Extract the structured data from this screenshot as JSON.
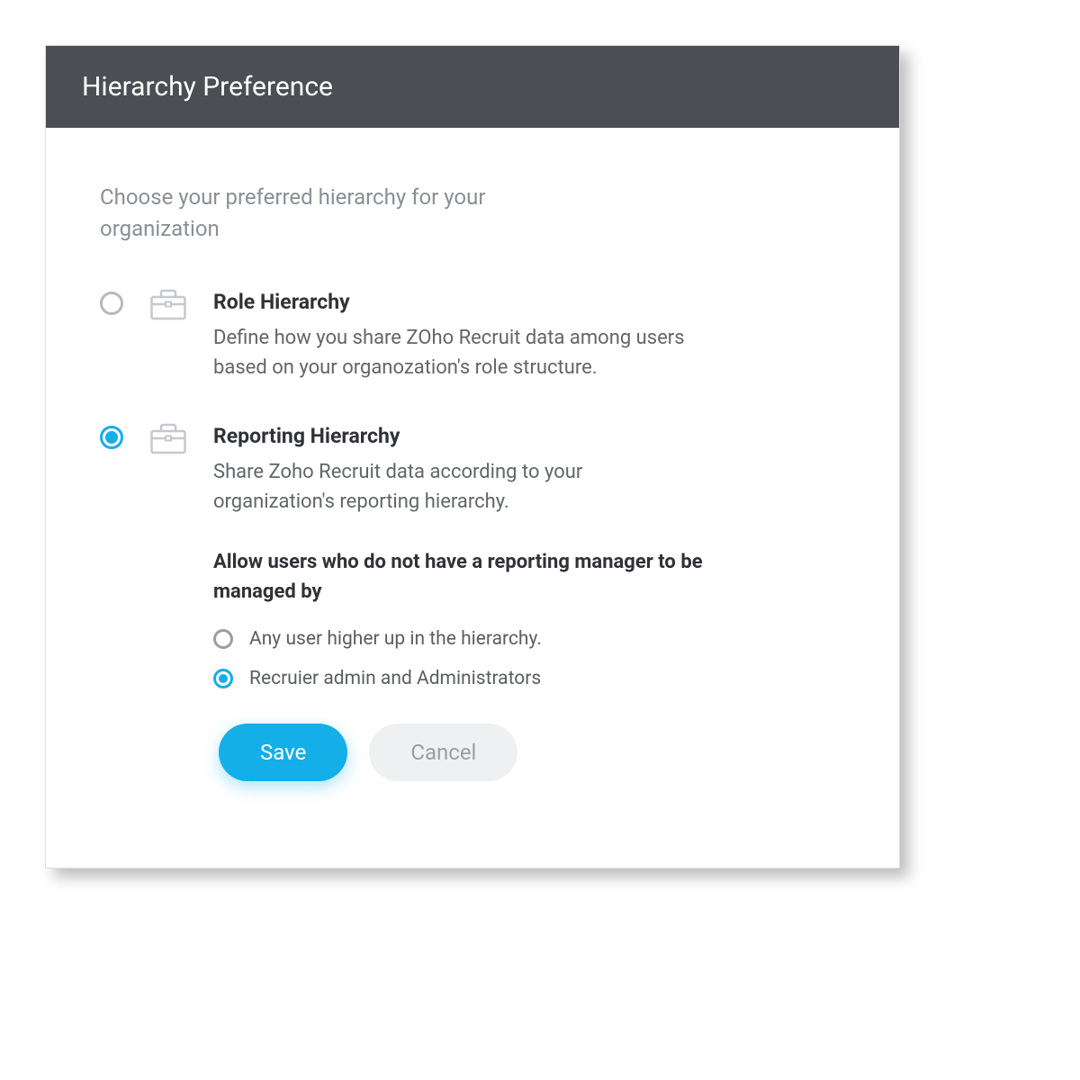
{
  "dialog": {
    "title": "Hierarchy Preference",
    "intro": "Choose your preferred hierarchy for your organization"
  },
  "options": [
    {
      "title": "Role Hierarchy",
      "description": "Define how you share ZOho Recruit data among users based on your organozation's role structure.",
      "selected": false
    },
    {
      "title": "Reporting Hierarchy",
      "description": "Share Zoho Recruit data according to your organization's reporting hierarchy.",
      "selected": true,
      "sub_heading": "Allow users who do not have a reporting manager to be managed by",
      "sub_options": [
        {
          "label": "Any user higher up in the hierarchy.",
          "selected": false
        },
        {
          "label": "Recruier admin and Administrators",
          "selected": true
        }
      ]
    }
  ],
  "buttons": {
    "save": "Save",
    "cancel": "Cancel"
  },
  "colors": {
    "header_bg": "#4b4e53",
    "accent": "#14aee8"
  }
}
